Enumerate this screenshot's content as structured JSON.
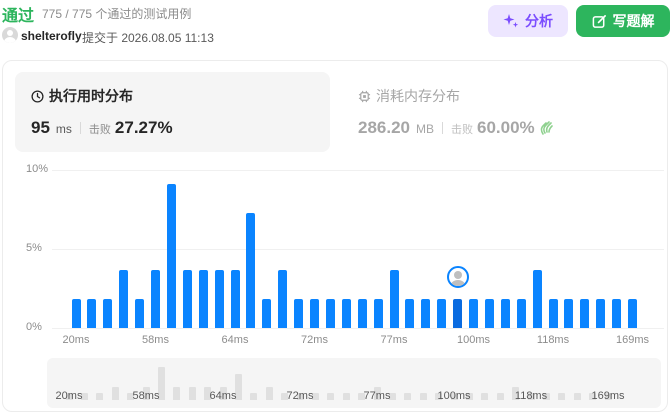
{
  "header": {
    "status": "通过",
    "testcases": "775 / 775 个通过的测试用例",
    "username": "shelterofly",
    "submitted": "提交于 2026.08.05 11:13",
    "analyze_label": "分析",
    "solution_label": "写题解"
  },
  "runtime": {
    "title": "执行用时分布",
    "value": "95",
    "unit": "ms",
    "beats_label": "击败",
    "beats": "27.27%"
  },
  "memory": {
    "title": "消耗内存分布",
    "value": "286.20",
    "unit": "MB",
    "beats_label": "击败",
    "beats": "60.00%"
  },
  "colors": {
    "accepted": "#2db55d",
    "bar": "#0a84ff",
    "analyze_bg": "#ede6ff",
    "analyze_fg": "#7b4dff"
  },
  "icons": [
    "clock-icon",
    "chip-icon",
    "sparkle-icon",
    "edit-icon",
    "clap-icon"
  ],
  "chart_data": {
    "type": "bar",
    "ylabel": "",
    "xlabel": "",
    "y_ticks": [
      "10%",
      "5%",
      "0%"
    ],
    "ylim": [
      0,
      10
    ],
    "x_tick_labels": [
      "20ms",
      "58ms",
      "64ms",
      "72ms",
      "77ms",
      "100ms",
      "118ms",
      "169ms"
    ],
    "x_tick_bar_index": [
      0,
      5,
      10,
      15,
      20,
      25,
      30,
      35
    ],
    "values": [
      1.82,
      1.82,
      1.82,
      3.64,
      1.82,
      3.64,
      9.09,
      3.64,
      3.64,
      3.64,
      3.64,
      7.27,
      1.82,
      3.64,
      1.82,
      1.82,
      1.82,
      1.82,
      1.82,
      1.82,
      3.64,
      1.82,
      1.82,
      1.82,
      1.82,
      1.82,
      1.82,
      1.82,
      1.82,
      3.64,
      1.82,
      1.82,
      1.82,
      1.82,
      1.82,
      1.82
    ],
    "highlight_index": 24
  },
  "overview_ticks": [
    "20ms",
    "58ms",
    "64ms",
    "72ms",
    "77ms",
    "100ms",
    "118ms",
    "169ms"
  ]
}
